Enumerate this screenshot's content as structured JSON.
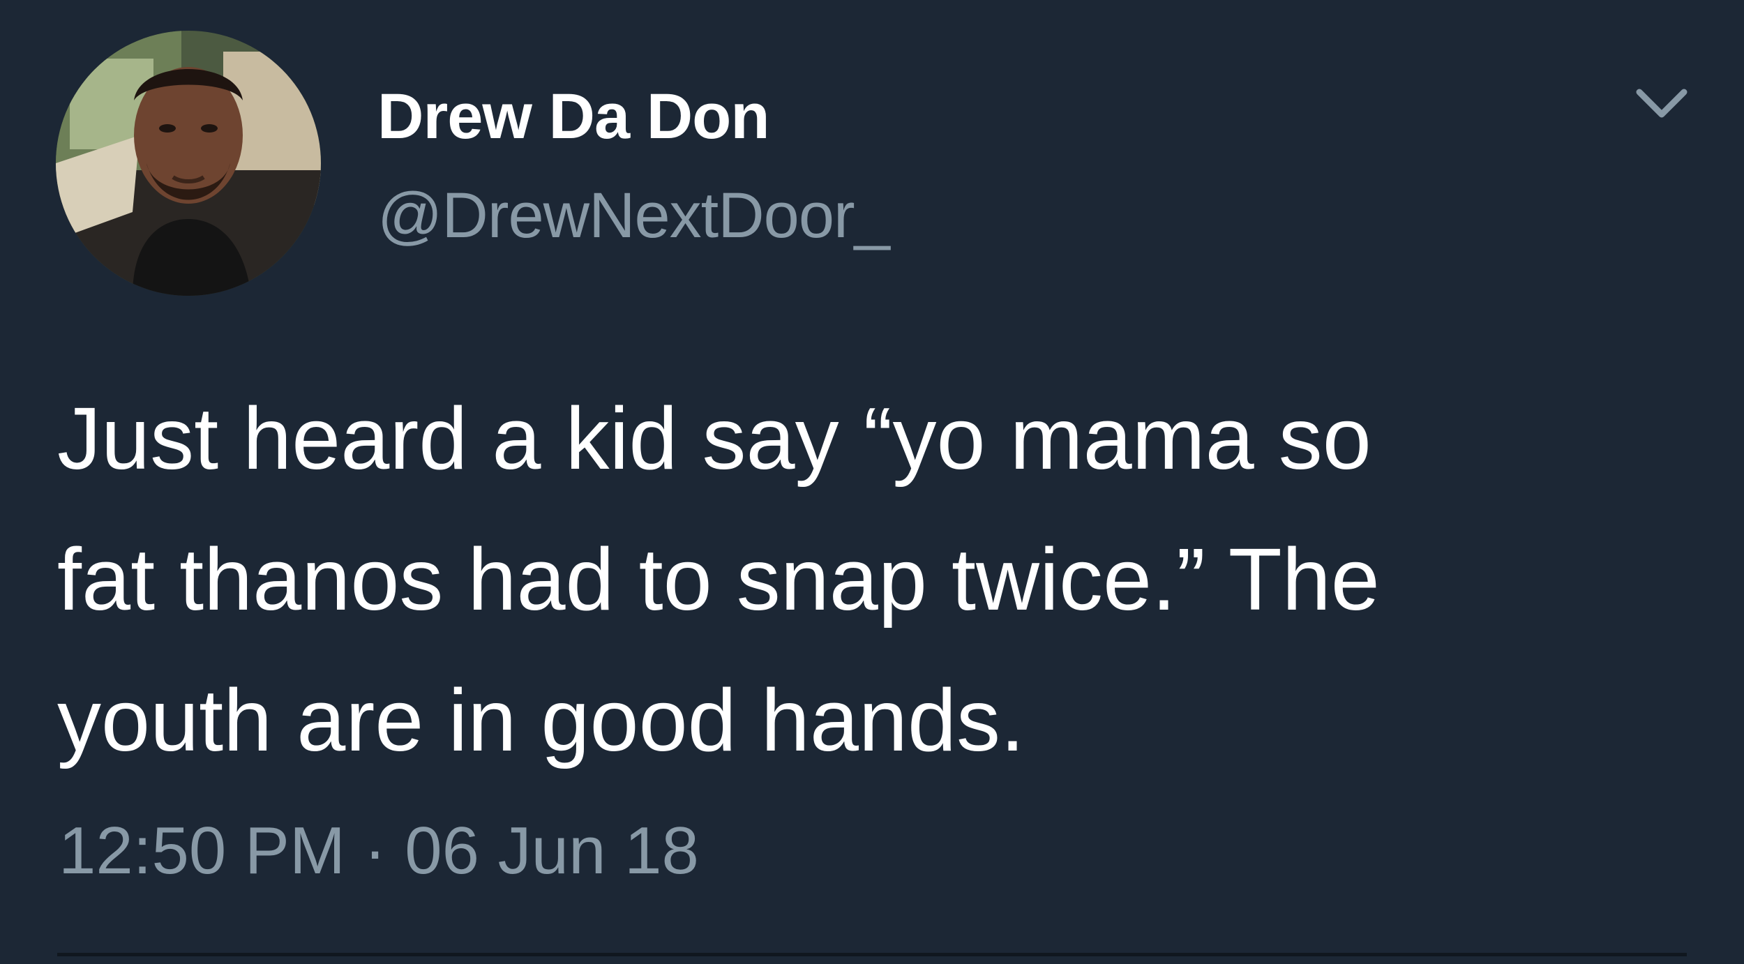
{
  "tweet": {
    "display_name": "Drew Da Don",
    "handle": "@DrewNextDoor_",
    "text_lines": [
      "Just heard a kid say “yo mama so",
      "fat thanos had to snap twice.” The",
      "youth are in good hands."
    ],
    "timestamp": "12:50 PM · 06 Jun 18"
  },
  "icons": {
    "avatar": "profile-photo",
    "menu": "chevron-down-icon"
  },
  "colors": {
    "background": "#1c2735",
    "primary_text": "#ffffff",
    "secondary_text": "#8899a6"
  }
}
